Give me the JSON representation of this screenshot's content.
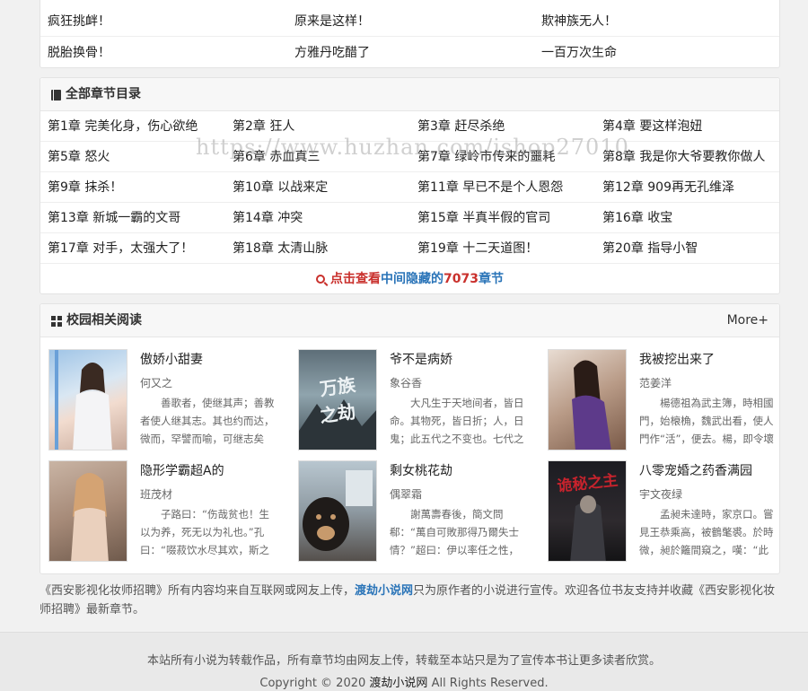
{
  "latest_chapters": [
    [
      "疯狂挑衅！",
      "原来是这样！",
      "欺神族无人！"
    ],
    [
      "脱胎换骨！",
      "方雅丹吃醋了",
      "一百万次生命"
    ]
  ],
  "catalog": {
    "title": "全部章节目录",
    "chapters": [
      [
        "第1章 完美化身，伤心欲绝",
        "第2章 狂人",
        "第3章 赶尽杀绝",
        "第4章 要这样泡妞"
      ],
      [
        "第5章 怒火",
        "第6章 赤血真三",
        "第7章 绿岭市传来的噩耗",
        "第8章 我是你大爷要教你做人"
      ],
      [
        "第9章 抹杀！",
        "第10章 以战来定",
        "第11章 早已不是个人恩怨",
        "第12章 909再无孔维泽"
      ],
      [
        "第13章 新城一霸的文哥",
        "第14章 冲突",
        "第15章 半真半假的官司",
        "第16章 收宝"
      ],
      [
        "第17章 对手，太强大了！",
        "第18章 太清山脉",
        "第19章 十二天道图！",
        "第20章 指导小智"
      ]
    ],
    "more": {
      "prefix": "点击查看",
      "middle": "中间隐藏的",
      "count": "7073",
      "suffix": "章节"
    },
    "watermark": "https://www.huzhan.com/ishop27010"
  },
  "related": {
    "title": "校园相关阅读",
    "more_label": "More+",
    "books": [
      {
        "title": "傲娇小甜妻",
        "author": "何又之",
        "desc": "善歌者，使继其声；善教者使人继其志。其也约而达，微而，罕譬而喻，可继志矣"
      },
      {
        "title": "爷不是病娇",
        "author": "象谷香",
        "desc": "大凡生于天地间者，皆日命。其物死，皆日折；人，日鬼；此五代之不变也。七代之"
      },
      {
        "title": "我被挖出来了",
        "author": "范姜洋",
        "desc": "楊德祖為武主簿，時相國門，始榱桷，魏武出看，使人門作“活”，便去。楊，即令壞之"
      },
      {
        "title": "隐形学霸超A的",
        "author": "班茂材",
        "desc": "子路曰：“伤哉贫也！生以为养，死无以为礼也。”孔曰：“啜菽饮水尽其欢，斯之孝；敛"
      },
      {
        "title": "剩女桃花劫",
        "author": "偶翠霜",
        "desc": "謝萬壽春後，簡文問郗：“萬自可敗那得乃爾失士情？”超曰：伊以率任之性，欲區別智"
      },
      {
        "title": "八零宠婚之药香满园",
        "author": "宇文夜绿",
        "desc": "孟昶未達時，家京口。嘗見王恭乘高，被鶴氅裘。於時微，昶於籬間窺之，嘆：“此真"
      }
    ]
  },
  "disclaimer": {
    "part1": "《西安影视化妆师招聘》所有内容均来自互联网或网友上传，",
    "site": "渡劫小说网",
    "part2": "只为原作者的小说进行宣传。欢迎各位书友支持并收藏《西安影视化妆师招聘》最新章节。"
  },
  "footer": {
    "line1": "本站所有小说为转载作品，所有章节均由网友上传，转载至本站只是为了宣传本书让更多读者欣赏。",
    "copyright_prefix": "Copyright © 2020",
    "site_name": "渡劫小说网",
    "copyright_suffix": "All Rights Reserved."
  }
}
